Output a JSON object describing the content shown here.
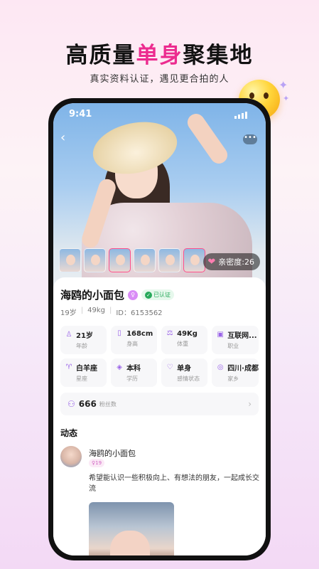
{
  "headline": {
    "part1": "高质量",
    "highlight": "单身",
    "part2": "聚集地"
  },
  "subline": "真实资料认证，遇见更合拍的人",
  "status": {
    "time": "9:41"
  },
  "nav": {
    "back": "‹",
    "more": "•••"
  },
  "intimacy": "亲密度:26",
  "profile": {
    "name": "海鸥的小面包",
    "gender_icon": "female-icon",
    "verified": "已认证",
    "age": "19岁",
    "weight": "49kg",
    "id": "ID：6153562"
  },
  "info": [
    {
      "icon": "person-icon",
      "value": "21岁",
      "label": "年龄"
    },
    {
      "icon": "ruler-icon",
      "value": "168cm",
      "label": "身高"
    },
    {
      "icon": "scale-icon",
      "value": "49Kg",
      "label": "体重"
    },
    {
      "icon": "briefcase-icon",
      "value": "互联网...",
      "label": "职业"
    },
    {
      "icon": "aries-icon",
      "value": "白羊座",
      "label": "星座"
    },
    {
      "icon": "graduation-icon",
      "value": "本科",
      "label": "学历"
    },
    {
      "icon": "heart-outline-icon",
      "value": "单身",
      "label": "感情状态"
    },
    {
      "icon": "location-icon",
      "value": "四川·成都",
      "label": "家乡"
    }
  ],
  "fans": {
    "count": "666",
    "label": "粉丝数"
  },
  "section_title": "动态",
  "post": {
    "name": "海鸥的小面包",
    "age": "19",
    "text": "希望能认识一些积极向上、有想法的朋友，一起成长交流"
  },
  "colors": {
    "accent": "#ec2b8f",
    "purple": "#9a63e8",
    "verified": "#27a95a"
  }
}
